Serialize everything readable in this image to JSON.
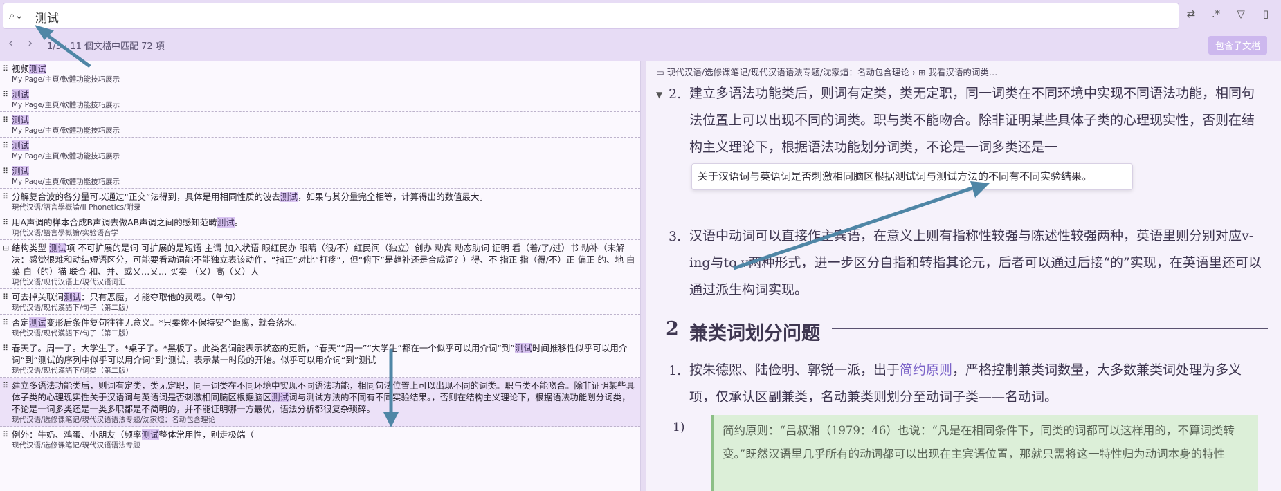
{
  "search": {
    "value": "测试",
    "placeholder": ""
  },
  "nav": {
    "match_info": "1/5 · 11 個文檔中匹配 72 項",
    "subdocs_label": "包含子文檔"
  },
  "results": [
    {
      "title_pre": "视频",
      "title_hit": "测试",
      "title_post": "",
      "path": "My Page/主頁/軟體功能技巧展示"
    },
    {
      "title_pre": "",
      "title_hit": "测试",
      "title_post": "",
      "path": "My Page/主頁/軟體功能技巧展示"
    },
    {
      "title_pre": "",
      "title_hit": "测试",
      "title_post": "",
      "path": "My Page/主頁/軟體功能技巧展示"
    },
    {
      "title_pre": "",
      "title_hit": "测试",
      "title_post": "",
      "path": "My Page/主頁/軟體功能技巧展示"
    },
    {
      "title_pre": "",
      "title_hit": "测试",
      "title_post": "",
      "path": "My Page/主頁/軟體功能技巧展示"
    },
    {
      "title_pre": "分解复合波的各分量可以通过“正交”法得到，具体是用相同性质的波去",
      "title_hit": "测试",
      "title_post": "，如果与其分量完全相等，计算得出的数值最大。",
      "path": "現代汉语/語言學概論/II Phonetics/附录"
    },
    {
      "title_pre": "用A声调的样本合成B声调去做AB声调之间的感知范畴",
      "title_hit": "测试",
      "title_post": "。",
      "path": "現代汉语/語言學概論/实验语音学"
    },
    {
      "title_pre": "结构类型 ",
      "title_hit": "测试",
      "title_post": "项 不可扩展的是词 可扩展的是短语 主谓 加入状语 眼红民办 眼睛（很/不）红民间（独立）创办 动宾 动态助词 证明 看（着/了/过）书 动补（未解决：感觉很难和动结短语区分，可能要看动词能不能独立表该动作，“指正”对比“打疼”，但“俯下”是趋补还是合成词？）得、不 指正 指（得/不）正 偏正 的、地 白菜 白（的）猫 联合 和、并、或又…又… 买卖 （又）高（又）大",
      "path": "現代汉语/现代汉语上/現代汉语词汇",
      "table": true
    },
    {
      "title_pre": "可去掉关联词",
      "title_hit": "测试",
      "title_post": "：只有恶魔，才能夺取他的灵魂。（单句）",
      "path": "现代汉语/现代漢語下/句子（第二版）"
    },
    {
      "title_pre": "否定",
      "title_hit": "测试",
      "title_post": "变形后条件复句往往无意义。*只要你不保持安全距离，就会落水。",
      "path": "现代汉语/现代漢語下/句子（第二版）"
    },
    {
      "title_pre": "春天了。周一了。大学生了。*桌子了。*黑板了。此类名词能表示状态的更新，“春天”“周一”“大学生”都在一个似乎可以用介词“到”",
      "title_hit": "测试",
      "title_post": "时间推移性似乎可以用介词“到”测试的序列中似乎可以用介词“到”测试，表示某一时段的开始。似乎可以用介词“到”测试",
      "path": "现代汉语/现代漢語下/词类（第二版）"
    },
    {
      "title_pre": "建立多语法功能类后，则词有定类，类无定职，同一词类在不同环境中实现不同语法功能，相同句法位置上可以出现不同的词类。职与类不能吻合。除非证明某些具体子类的心理现实性关于汉语词与英语词是否刺激相同脑区根据脑区",
      "title_hit": "测试",
      "title_post": "词与测试方法的不同有不同实验结果。，否则在结构主义理论下，根据语法功能划分词类，不论是一词多类还是一类多职都是不简明的，并不能证明哪一方最优，语法分析都很复杂琐碎。",
      "path": "现代汉语/选修课笔记/現代汉语语法专题/沈家煊：名动包含理论",
      "active": true
    },
    {
      "title_pre": "例外：牛奶、鸡蛋、小朋友（频率",
      "title_hit": "测试",
      "title_post": "整体常用性，别走极端（",
      "path": "现代汉语/选修课笔记/現代汉语语法专题"
    }
  ],
  "breadcrumb": {
    "path": "现代汉语/选修课笔记/现代汉语语法专题/沈家煊：名动包含理论",
    "sep": "›",
    "leaf": "我看汉语的词类…"
  },
  "doc": {
    "item2_num": "2.",
    "item2_text": "建立多语法功能类后，则词有定类，类无定职，同一词类在不同环境中实现不同语法功能，相同句法位置上可以出现不同的词类。职与类不能吻合。除非证明某些具体子类的心理现实性，否则在结构主义理论下，根据语法功能划分词类，不论是一词多类还是一",
    "popup": "关于汉语词与英语词是否刺激相同脑区根据测试词与测试方法的不同有不同实验结果。",
    "item3_num": "3.",
    "item3_text": "汉语中动词可以直接作主宾语，在意义上则有指称性较强与陈述性较强两种，英语里则分别对应v-ing与to v两种形式，进一步区分自指和转指其论元，后者可以通过后接“的”实现，在英语里还可以通过派生构词实现。",
    "h2_num": "2",
    "h2_text": "兼类词划分问题",
    "item1_num": "1.",
    "item1_pre": "按朱德熙、陆俭明、郭锐一派，出于",
    "item1_link": "简约原则",
    "item1_post": "，严格控制兼类词数量，大多数兼类词处理为多义项，仅承认区副兼类，名动兼类则划分至动词子类——名动词。",
    "sub_num": "1)",
    "callout": "简约原则：“吕叔湘（1979：46）也说：“凡是在相同条件下，同类的词都可以这样用的，不算词类转变。”既然汉语里几乎所有的动词都可以出现在主宾语位置，那就只需将这一特性归为动词本身的特性"
  }
}
